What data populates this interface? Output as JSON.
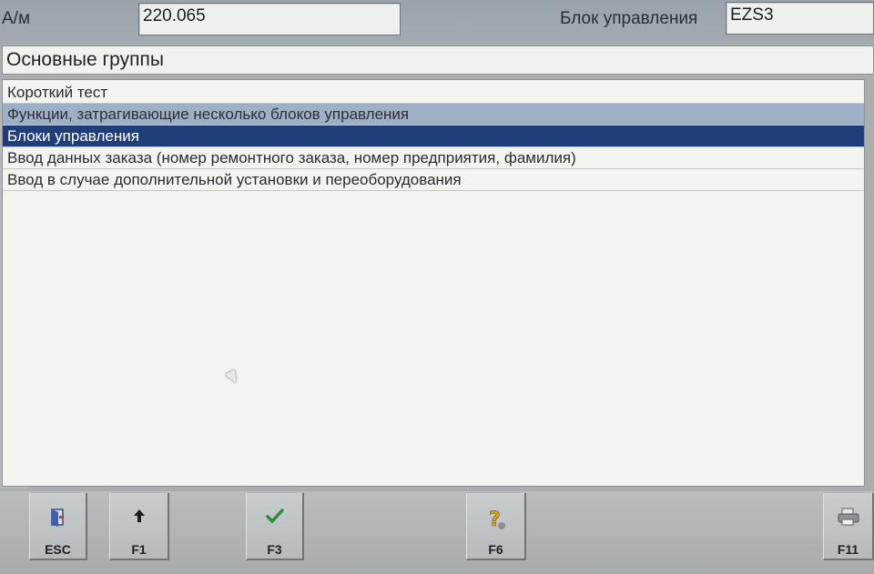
{
  "header": {
    "vehicle_label": "А/м",
    "vehicle_value": "220.065",
    "control_unit_label": "Блок управления",
    "control_unit_value": "EZS3"
  },
  "main": {
    "group_title": "Основные группы",
    "items": [
      {
        "label": "Короткий тест",
        "state": "normal"
      },
      {
        "label": "Функции, затрагивающие несколько блоков управления",
        "state": "highlighted"
      },
      {
        "label": "Блоки управления",
        "state": "selected"
      },
      {
        "label": "Ввод данных заказа (номер ремонтного заказа, номер предприятия, фамилия)",
        "state": "normal"
      },
      {
        "label": "Ввод в случае дополнительной установки и переоборудования",
        "state": "normal"
      }
    ]
  },
  "toolbar": {
    "buttons": [
      {
        "key": "ESC",
        "icon": "exit-door-icon"
      },
      {
        "key": "F1",
        "icon": "up-arrow-icon"
      },
      {
        "key": "F3",
        "icon": "checkmark-icon"
      },
      {
        "key": "F6",
        "icon": "help-question-icon"
      },
      {
        "key": "F11",
        "icon": "printer-icon"
      }
    ]
  },
  "colors": {
    "selected_bg": "#1f3e7a",
    "highlight_bg": "#9fb0c6",
    "check_green": "#2f8a3a",
    "help_yellow": "#d9a21c"
  }
}
